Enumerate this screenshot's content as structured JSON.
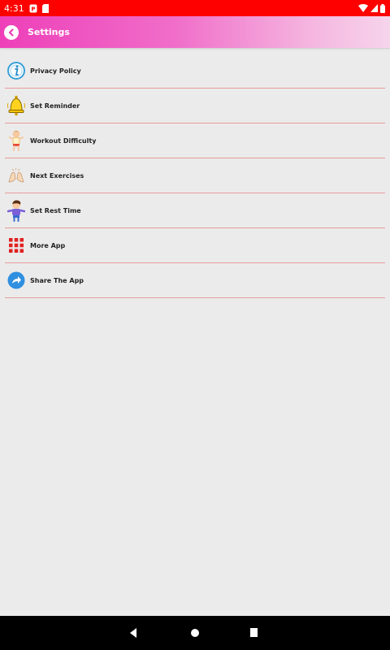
{
  "status_bar": {
    "time": "4:31",
    "icons": [
      "notification-app-icon",
      "sd-card-icon",
      "wifi-icon",
      "signal-icon",
      "battery-icon"
    ]
  },
  "app_bar": {
    "title": "Settings",
    "back_icon": "chevron-left-icon"
  },
  "settings": {
    "items": [
      {
        "label": "Privacy Policy",
        "icon": "info-icon"
      },
      {
        "label": "Set Reminder",
        "icon": "bell-icon"
      },
      {
        "label": "Workout Difficulty",
        "icon": "kid-icon"
      },
      {
        "label": "Next Exercises",
        "icon": "clapping-hands-icon"
      },
      {
        "label": "Set Rest Time",
        "icon": "boy-icon"
      },
      {
        "label": "More App",
        "icon": "grid-icon"
      },
      {
        "label": "Share The App",
        "icon": "share-arrow-icon"
      }
    ]
  },
  "nav_bar": {
    "buttons": [
      "back-triangle-icon",
      "home-circle-icon",
      "recents-square-icon"
    ]
  },
  "colors": {
    "status_bar": "#ff0000",
    "app_bar_start": "#ee3fb9",
    "app_bar_end": "#f6d4ec",
    "divider": "#e89b9b",
    "background": "#ebebeb"
  }
}
